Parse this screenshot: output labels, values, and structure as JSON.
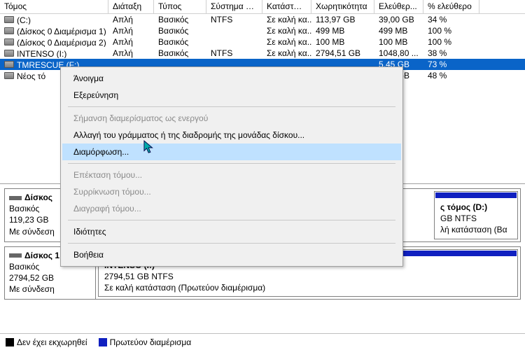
{
  "columns": {
    "volume": "Τόμος",
    "layout": "Διάταξη",
    "type": "Τύπος",
    "fs": "Σύστημα αρ...",
    "status": "Κατάσταση",
    "capacity": "Χωρητικότητα",
    "free": "Ελεύθερ...",
    "pctfree": "% ελεύθερο"
  },
  "rows": [
    {
      "volume": "(C:)",
      "layout": "Απλή",
      "type": "Βασικός",
      "fs": "NTFS",
      "status": "Σε καλή κα...",
      "capacity": "113,97 GB",
      "free": "39,00 GB",
      "pctfree": "34 %"
    },
    {
      "volume": "(Δίσκος 0 Διαμέρισμα 1)",
      "layout": "Απλή",
      "type": "Βασικός",
      "fs": "",
      "status": "Σε καλή κα...",
      "capacity": "499 MB",
      "free": "499 MB",
      "pctfree": "100 %"
    },
    {
      "volume": "(Δίσκος 0 Διαμέρισμα 2)",
      "layout": "Απλή",
      "type": "Βασικός",
      "fs": "",
      "status": "Σε καλή κα...",
      "capacity": "100 MB",
      "free": "100 MB",
      "pctfree": "100 %"
    },
    {
      "volume": "INTENSO (I:)",
      "layout": "Απλή",
      "type": "Βασικός",
      "fs": "NTFS",
      "status": "Σε καλή κα...",
      "capacity": "2794,51 GB",
      "free": "1048,80 ...",
      "pctfree": "38 %"
    },
    {
      "volume": "TMRESCUE (F:)",
      "layout": "",
      "type": "",
      "fs": "",
      "status": "",
      "capacity": "",
      "free": "5,45 GB",
      "pctfree": "73 %",
      "selected": true
    },
    {
      "volume": "Νέος τό",
      "layout": "",
      "type": "",
      "fs": "",
      "status": "",
      "capacity": "",
      "free": "2,24 GB",
      "pctfree": "48 %"
    }
  ],
  "ctx": {
    "open": "Άνοιγμα",
    "explore": "Εξερεύνηση",
    "markactive": "Σήμανση διαμερίσματος ως ενεργού",
    "changeletter": "Αλλαγή  του γράμματος ή της διαδρομής της μονάδας δίσκου...",
    "format": "Διαμόρφωση...",
    "extend": "Επέκταση τόμου...",
    "shrink": "Συρρίκνωση τόμου...",
    "delete": "Διαγραφή τόμου...",
    "properties": "Ιδιότητες",
    "help": "Βοήθεια"
  },
  "disk0": {
    "title": "Δίσκος",
    "kind": "Βασικός",
    "size": "119,23 GB",
    "state": "Με σύνδεση",
    "p_title": "ς τόμος  (D:)",
    "p_line2": "GB NTFS",
    "p_line3": "λή κατάσταση (Βα"
  },
  "disk1": {
    "title": "Δίσκος 1",
    "kind": "Βασικός",
    "size": "2794,52 GB",
    "state": "Με σύνδεση",
    "p_title": "INTENSO  (I:)",
    "p_line2": "2794,51 GB NTFS",
    "p_line3": "Σε καλή κατάσταση (Πρωτεύον διαμέρισμα)"
  },
  "legend": {
    "unallocated": "Δεν έχει εκχωρηθεί",
    "primary": "Πρωτεύον διαμέρισμα"
  }
}
